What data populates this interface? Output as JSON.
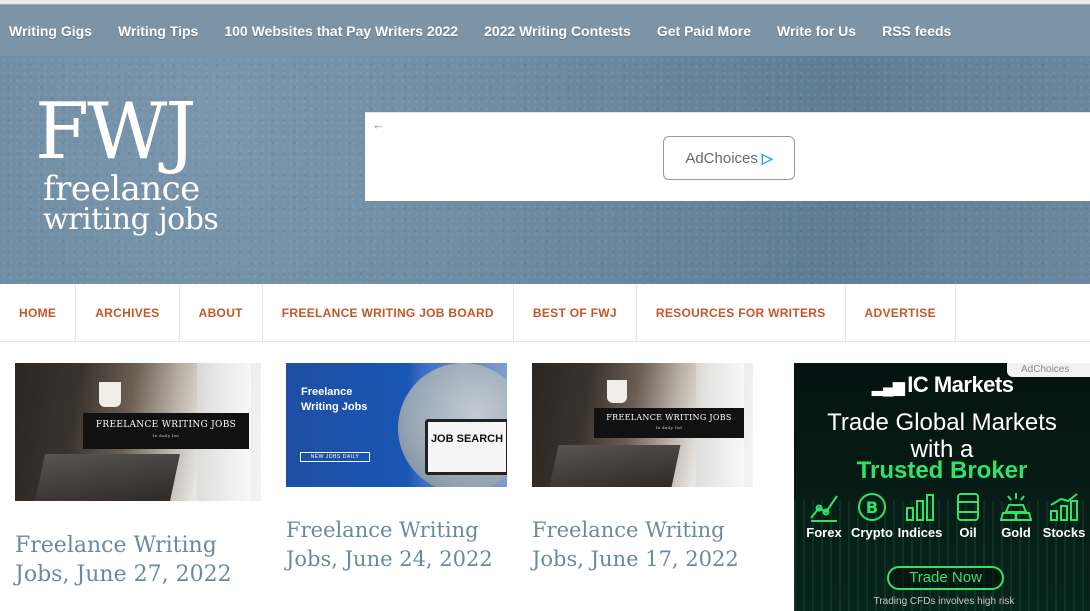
{
  "topnav": {
    "items": [
      {
        "label": "Writing Gigs"
      },
      {
        "label": "Writing Tips"
      },
      {
        "label": "100 Websites that Pay Writers 2022"
      },
      {
        "label": "2022 Writing Contests"
      },
      {
        "label": "Get Paid More"
      },
      {
        "label": "Write for Us"
      },
      {
        "label": "RSS feeds"
      }
    ]
  },
  "header": {
    "logo": {
      "mark": "FWJ",
      "line1": "freelance",
      "line2": "writing jobs"
    },
    "ad": {
      "back_icon": "←",
      "adchoices_label": "AdChoices",
      "adchoices_icon": "▷"
    }
  },
  "mainnav": {
    "items": [
      {
        "label": "HOME"
      },
      {
        "label": "ARCHIVES"
      },
      {
        "label": "ABOUT"
      },
      {
        "label": "FREELANCE WRITING JOB BOARD"
      },
      {
        "label": "BEST OF FWJ"
      },
      {
        "label": "RESOURCES FOR WRITERS"
      },
      {
        "label": "ADVERTISE"
      }
    ]
  },
  "posts": [
    {
      "title": "Freelance Writing Jobs, June 27, 2022",
      "thumb_label": "FREELANCE WRITING JOBS",
      "thumb_sub": "In daily list"
    },
    {
      "title": "Freelance Writing Jobs, June 24, 2022",
      "thumb_text": "Freelance Writing Jobs",
      "thumb_pill": "NEW JOBS DAILY",
      "thumb_screen": "JOB SEARCH"
    },
    {
      "title": "Freelance Writing Jobs, June 17, 2022",
      "thumb_label": "FREELANCE WRITING JOBS",
      "thumb_sub": "In daily list"
    }
  ],
  "side_ad": {
    "adchoices": "AdChoices",
    "brand": "IC Markets",
    "line1": "Trade Global Markets",
    "line2": "with a",
    "line3": "Trusted Broker",
    "items": [
      {
        "label": "Forex",
        "icon": "chart-icon"
      },
      {
        "label": "Crypto",
        "icon": "bitcoin-icon"
      },
      {
        "label": "Indices",
        "icon": "bars-icon"
      },
      {
        "label": "Oil",
        "icon": "barrel-icon"
      },
      {
        "label": "Gold",
        "icon": "gold-icon"
      },
      {
        "label": "Stocks",
        "icon": "stocks-icon"
      }
    ],
    "cta": "Trade Now",
    "footer": "Trading CFDs involves high risk"
  },
  "colors": {
    "topnav_bg": "#7d94a6",
    "mainnav_text": "#c0592a",
    "post_title": "#6a8aa0",
    "ad_green": "#2fe26b"
  }
}
